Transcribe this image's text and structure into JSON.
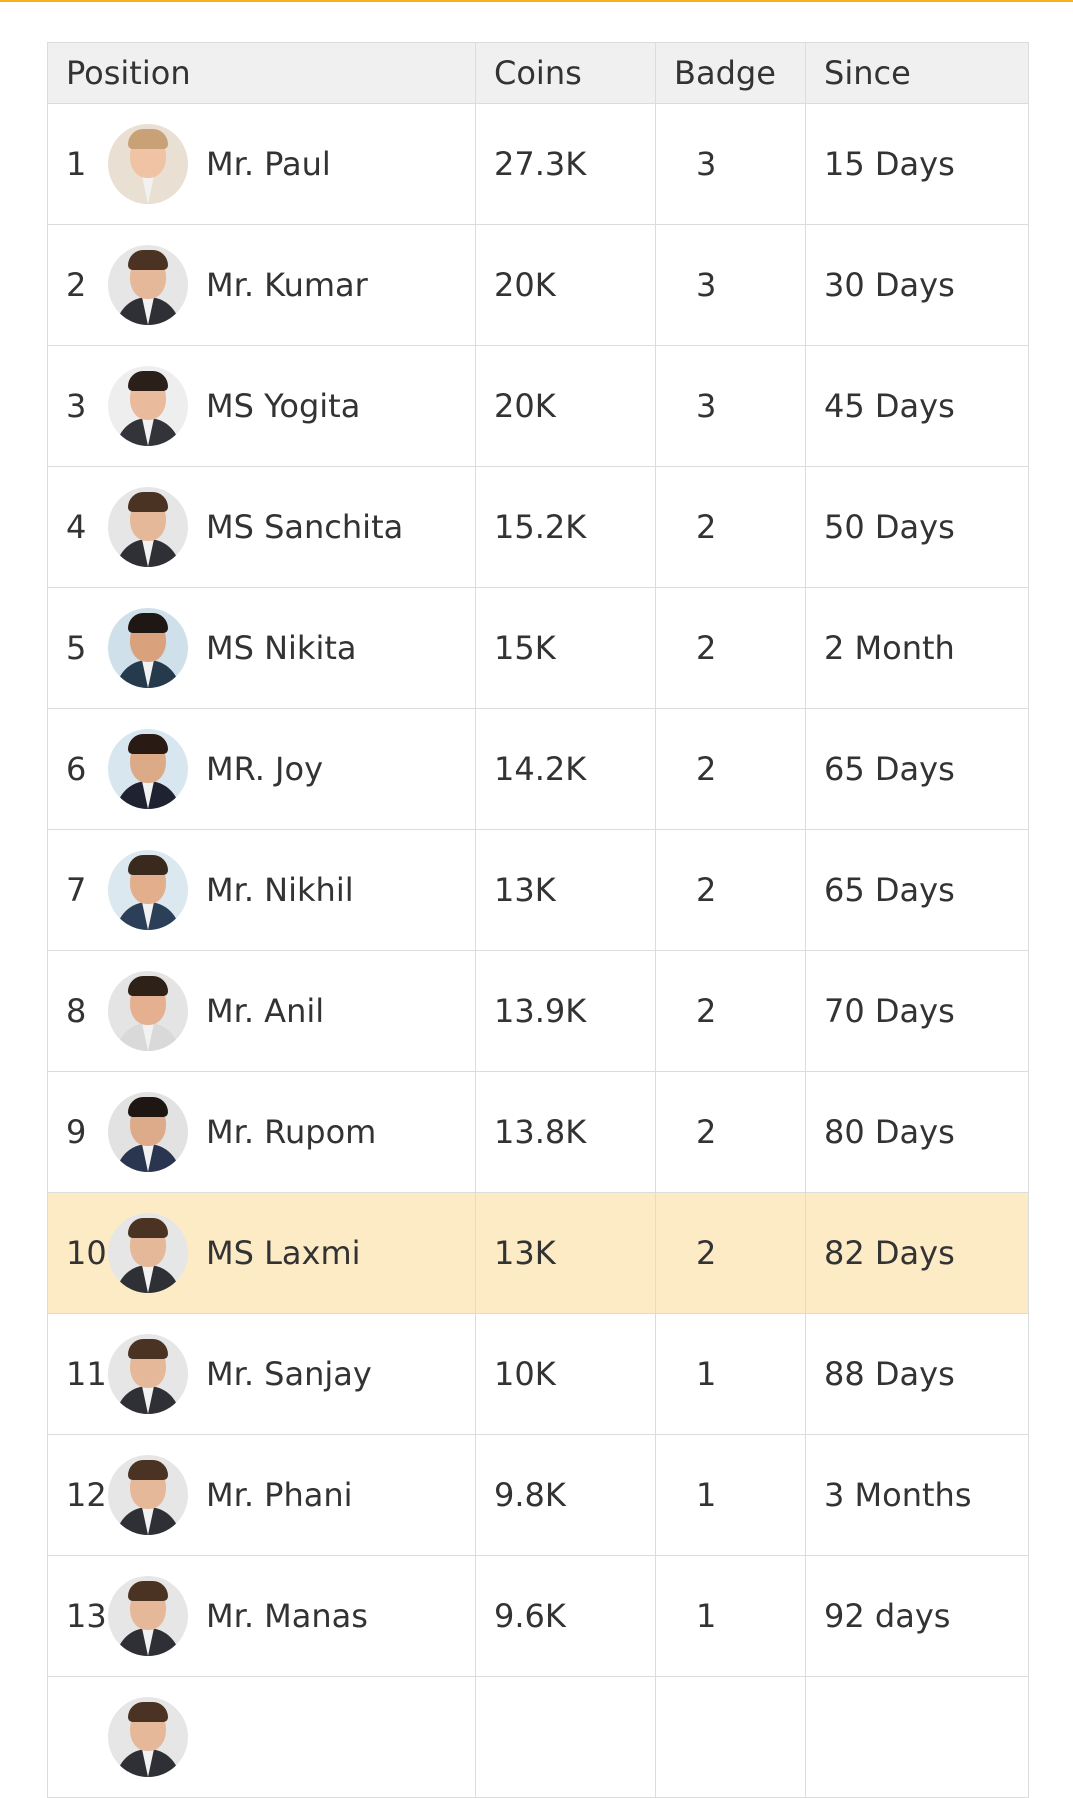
{
  "colors": {
    "accent_bar": "#f5b11c",
    "header_bg": "#f0f0f0",
    "highlight_row": "#fdebc5",
    "border": "#dcdcdc"
  },
  "leaderboard": {
    "columns": [
      "Position",
      "Coins",
      "Badge",
      "Since"
    ],
    "highlight_position": "10",
    "rows": [
      {
        "position": "1",
        "name": "Mr. Paul",
        "coins": "27.3K",
        "badge": "3",
        "since": "15 Days",
        "avatar": "avatar-woman-blonde-icon",
        "palette": {
          "bg": "#e9dfd2",
          "skin": "#efc3a4",
          "hair": "#c8a276",
          "body": "#e9dfd2"
        }
      },
      {
        "position": "2",
        "name": "Mr. Kumar",
        "coins": "20K",
        "badge": "3",
        "since": "30 Days",
        "avatar": "avatar-man-glasses-icon",
        "palette": {
          "bg": "#e6e6e6",
          "skin": "#e6b89a",
          "hair": "#4a3322",
          "body": "#2e3036"
        }
      },
      {
        "position": "3",
        "name": "MS Yogita",
        "coins": "20K",
        "badge": "3",
        "since": "45 Days",
        "avatar": "avatar-man-smiling-icon",
        "palette": {
          "bg": "#eeeeee",
          "skin": "#e9bb9c",
          "hair": "#2b2019",
          "body": "#33343a"
        }
      },
      {
        "position": "4",
        "name": "MS Sanchita",
        "coins": "15.2K",
        "badge": "2",
        "since": "50 Days",
        "avatar": "avatar-man-glasses-icon",
        "palette": {
          "bg": "#e6e6e6",
          "skin": "#e6b89a",
          "hair": "#4a3322",
          "body": "#2e3036"
        }
      },
      {
        "position": "5",
        "name": "MS Nikita",
        "coins": "15K",
        "badge": "2",
        "since": "2 Month",
        "avatar": "avatar-man-office-icon",
        "palette": {
          "bg": "#cfe0ea",
          "skin": "#d9a27d",
          "hair": "#1f1713",
          "body": "#263a4e"
        }
      },
      {
        "position": "6",
        "name": "MR. Joy",
        "coins": "14.2K",
        "badge": "2",
        "since": "65 Days",
        "avatar": "avatar-woman-glasses-icon",
        "palette": {
          "bg": "#d8e6ef",
          "skin": "#ddaa88",
          "hair": "#2a1a14",
          "body": "#1f2230"
        }
      },
      {
        "position": "7",
        "name": "Mr. Nikhil",
        "coins": "13K",
        "badge": "2",
        "since": "65 Days",
        "avatar": "avatar-man-suit-icon",
        "palette": {
          "bg": "#dce8ef",
          "skin": "#e2ae8c",
          "hair": "#3a2a1e",
          "body": "#2b4058"
        }
      },
      {
        "position": "8",
        "name": "Mr. Anil",
        "coins": "13.9K",
        "badge": "2",
        "since": "70 Days",
        "avatar": "avatar-man-portrait-icon",
        "palette": {
          "bg": "#e4e4e4",
          "skin": "#e4b090",
          "hair": "#2d2118",
          "body": "#d9d9d9"
        }
      },
      {
        "position": "9",
        "name": "Mr. Rupom",
        "coins": "13.8K",
        "badge": "2",
        "since": "80 Days",
        "avatar": "avatar-man-beard-icon",
        "palette": {
          "bg": "#e2e2e2",
          "skin": "#ddaa8a",
          "hair": "#1e1612",
          "body": "#2a3650"
        }
      },
      {
        "position": "10",
        "name": "MS Laxmi",
        "coins": "13K",
        "badge": "2",
        "since": "82 Days",
        "avatar": "avatar-man-glasses-icon",
        "palette": {
          "bg": "#e6e6e6",
          "skin": "#e6b89a",
          "hair": "#4a3322",
          "body": "#2e3036"
        }
      },
      {
        "position": "11",
        "name": "Mr. Sanjay",
        "coins": "10K",
        "badge": "1",
        "since": "88 Days",
        "avatar": "avatar-man-glasses-icon",
        "palette": {
          "bg": "#e6e6e6",
          "skin": "#e6b89a",
          "hair": "#4a3322",
          "body": "#2e3036"
        }
      },
      {
        "position": "12",
        "name": "Mr. Phani",
        "coins": "9.8K",
        "badge": "1",
        "since": "3 Months",
        "avatar": "avatar-man-glasses-icon",
        "palette": {
          "bg": "#e6e6e6",
          "skin": "#e6b89a",
          "hair": "#4a3322",
          "body": "#2e3036"
        }
      },
      {
        "position": "13",
        "name": "Mr. Manas",
        "coins": "9.6K",
        "badge": "1",
        "since": "92 days",
        "avatar": "avatar-man-glasses-icon",
        "palette": {
          "bg": "#e6e6e6",
          "skin": "#e6b89a",
          "hair": "#4a3322",
          "body": "#2e3036"
        }
      },
      {
        "position": "",
        "name": "",
        "coins": "",
        "badge": "",
        "since": "",
        "avatar": "avatar-man-glasses-icon",
        "palette": {
          "bg": "#e6e6e6",
          "skin": "#e6b89a",
          "hair": "#4a3322",
          "body": "#2e3036"
        }
      }
    ]
  }
}
